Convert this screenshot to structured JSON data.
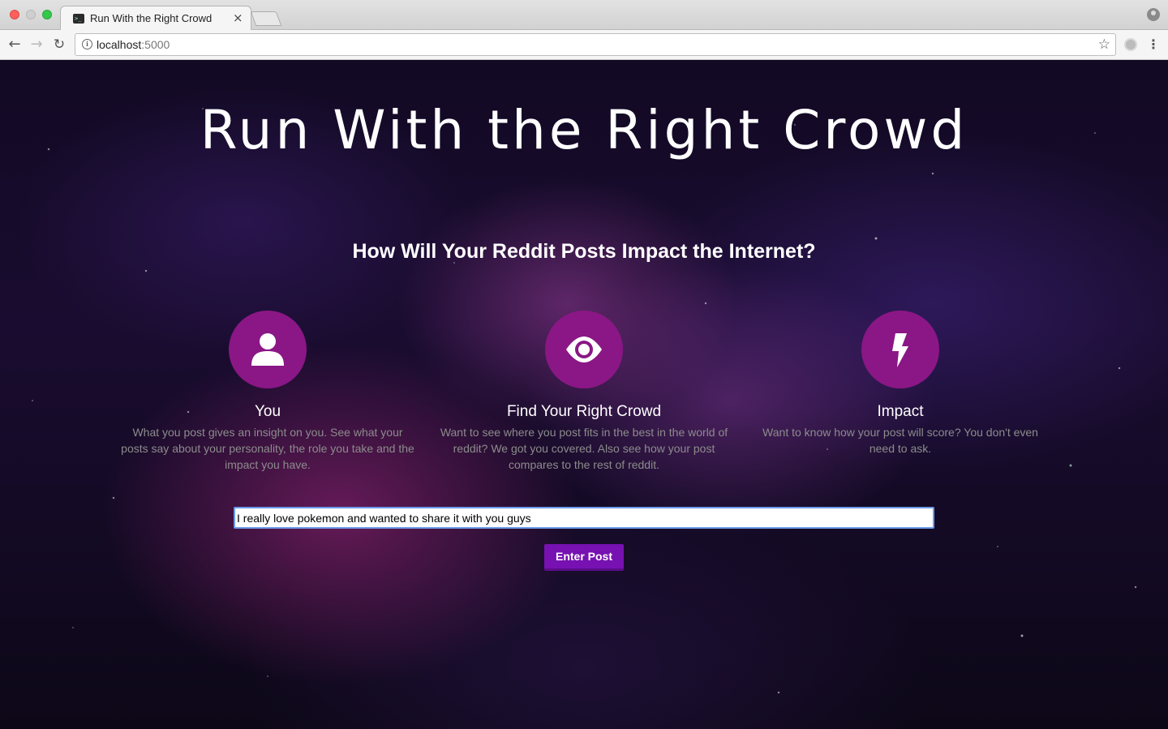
{
  "browser": {
    "tab_title": "Run With the Right Crowd",
    "tab_close": "×",
    "url_host": "localhost",
    "url_port": ":5000",
    "nav_back": "←",
    "nav_forward": "→",
    "nav_reload": "↻",
    "star": "☆",
    "menu": "⋮"
  },
  "page": {
    "title": "Run With the Right Crowd",
    "subtitle": "How Will Your Reddit Posts Impact the Internet?",
    "features": [
      {
        "icon": "user-icon",
        "heading": "You",
        "text": "What you post gives an insight on you. See what your posts say about your personality, the role you take and the impact you have."
      },
      {
        "icon": "eye-icon",
        "heading": "Find Your Right Crowd",
        "text": "Want to see where you post fits in the best in the world of reddit? We got you covered. Also see how your post compares to the rest of reddit."
      },
      {
        "icon": "lightning-icon",
        "heading": "Impact",
        "text": "Want to know how your post will score? You don't even need to ask."
      }
    ],
    "post_input_value": "I really love pokemon and wanted to share it with you guys",
    "submit_label": "Enter Post"
  },
  "colors": {
    "accent_circle": "#8a1785",
    "button": "#7711b2"
  }
}
